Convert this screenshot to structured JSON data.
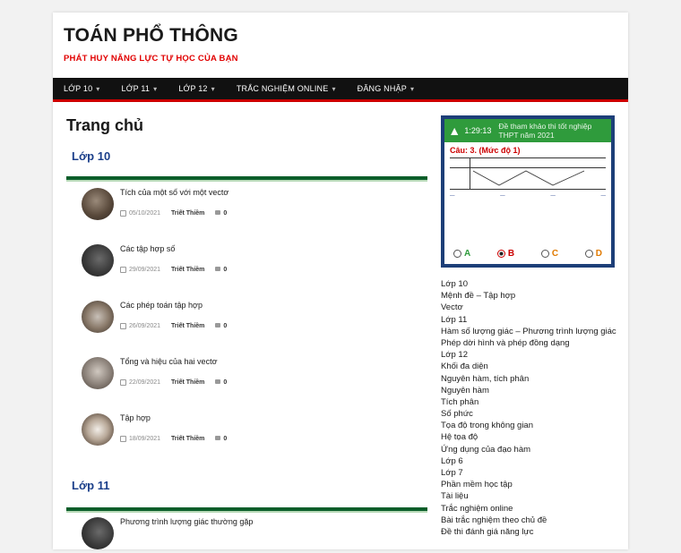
{
  "site": {
    "title": "TOÁN PHỔ THÔNG",
    "tagline": "PHÁT HUY NĂNG LỰC TỰ HỌC CỦA BẠN"
  },
  "nav": {
    "items": [
      {
        "label": "LỚP 10",
        "chevron": "chevron-down-icon"
      },
      {
        "label": "LỚP 11",
        "chevron": "chevron-down-icon"
      },
      {
        "label": "LỚP 12",
        "chevron": "chevron-down-icon"
      },
      {
        "label": "TRẮC NGHIỆM ONLINE",
        "chevron": "chevron-down-icon"
      },
      {
        "label": "ĐĂNG NHẬP",
        "chevron": "chevron-down-icon"
      }
    ],
    "accent": "#cc0000"
  },
  "main": {
    "title": "Trang chủ",
    "categories": [
      {
        "name": "Lớp 10",
        "posts": [
          {
            "title": "Tích của một số với một vectơ",
            "date": "05/10/2021",
            "author": "Triết Thiềm",
            "comments": "0"
          },
          {
            "title": "Các tập hợp số",
            "date": "29/09/2021",
            "author": "Triết Thiềm",
            "comments": "0"
          },
          {
            "title": "Các phép toán tập hợp",
            "date": "26/09/2021",
            "author": "Triết Thiềm",
            "comments": "0"
          },
          {
            "title": "Tổng và hiệu của hai vectơ",
            "date": "22/09/2021",
            "author": "Triết Thiềm",
            "comments": "0"
          },
          {
            "title": "Tập hợp",
            "date": "18/09/2021",
            "author": "Triết Thiềm",
            "comments": "0"
          }
        ]
      },
      {
        "name": "Lớp 11",
        "posts": [
          {
            "title": "Phương trình lượng giác thường gặp"
          }
        ]
      }
    ]
  },
  "widget": {
    "timer": "1:29:13",
    "text": "Đề tham khảo thi tốt nghiệp THPT năm 2021",
    "question": "Câu: 3. (Mức độ 1)",
    "options": [
      "A",
      "B",
      "C",
      "D"
    ],
    "selected": "B"
  },
  "sidebar": {
    "links": [
      "Lớp 10",
      "Mệnh đề – Tập hợp",
      "Vectơ",
      "Lớp 11",
      "Hàm số lượng giác – Phương trình lượng giác",
      "Phép dời hình và phép đồng dạng",
      "Lớp 12",
      "Khối đa diện",
      "Nguyên hàm, tích phân",
      "Nguyên hàm",
      "Tích phân",
      "Số phức",
      "Tọa độ trong không gian",
      "Hệ tọa độ",
      "Ứng dụng của đạo hàm",
      "Lớp 6",
      "Lớp 7",
      "Phần mềm học tập",
      "Tài liệu",
      "Trắc nghiệm online",
      "Bài trắc nghiệm theo chủ đề",
      "Đề thi đánh giá năng lực"
    ]
  }
}
